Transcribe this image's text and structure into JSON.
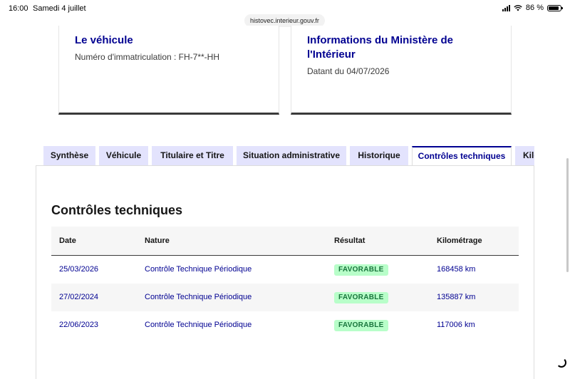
{
  "status_bar": {
    "time": "16:00",
    "date": "Samedi 4 juillet",
    "battery": "86 %",
    "url": "histovec.interieur.gouv.fr"
  },
  "cards": {
    "vehicle": {
      "title": "Le véhicule",
      "text": "Numéro d'immatriculation : FH-7**-HH"
    },
    "ministere": {
      "title": "Informations du Ministère de l'Intérieur",
      "text": "Datant du 04/07/2026"
    }
  },
  "tabs": [
    {
      "label": "Synthèse",
      "active": false
    },
    {
      "label": "Véhicule",
      "active": false
    },
    {
      "label": "Titulaire et Titre",
      "active": false
    },
    {
      "label": "Situation administrative",
      "active": false
    },
    {
      "label": "Historique",
      "active": false
    },
    {
      "label": "Contrôles techniques",
      "active": true
    },
    {
      "label": "Kilométrage",
      "active": false
    }
  ],
  "section": {
    "title": "Contrôles techniques"
  },
  "table": {
    "headers": [
      "Date",
      "Nature",
      "Résultat",
      "Kilométrage"
    ],
    "rows": [
      {
        "date": "25/03/2026",
        "nature": "Contrôle Technique Périodique",
        "result": "FAVORABLE",
        "km": "168458 km"
      },
      {
        "date": "27/02/2024",
        "nature": "Contrôle Technique Périodique",
        "result": "FAVORABLE",
        "km": "135887 km"
      },
      {
        "date": "22/06/2023",
        "nature": "Contrôle Technique Périodique",
        "result": "FAVORABLE",
        "km": "117006 km"
      }
    ]
  }
}
